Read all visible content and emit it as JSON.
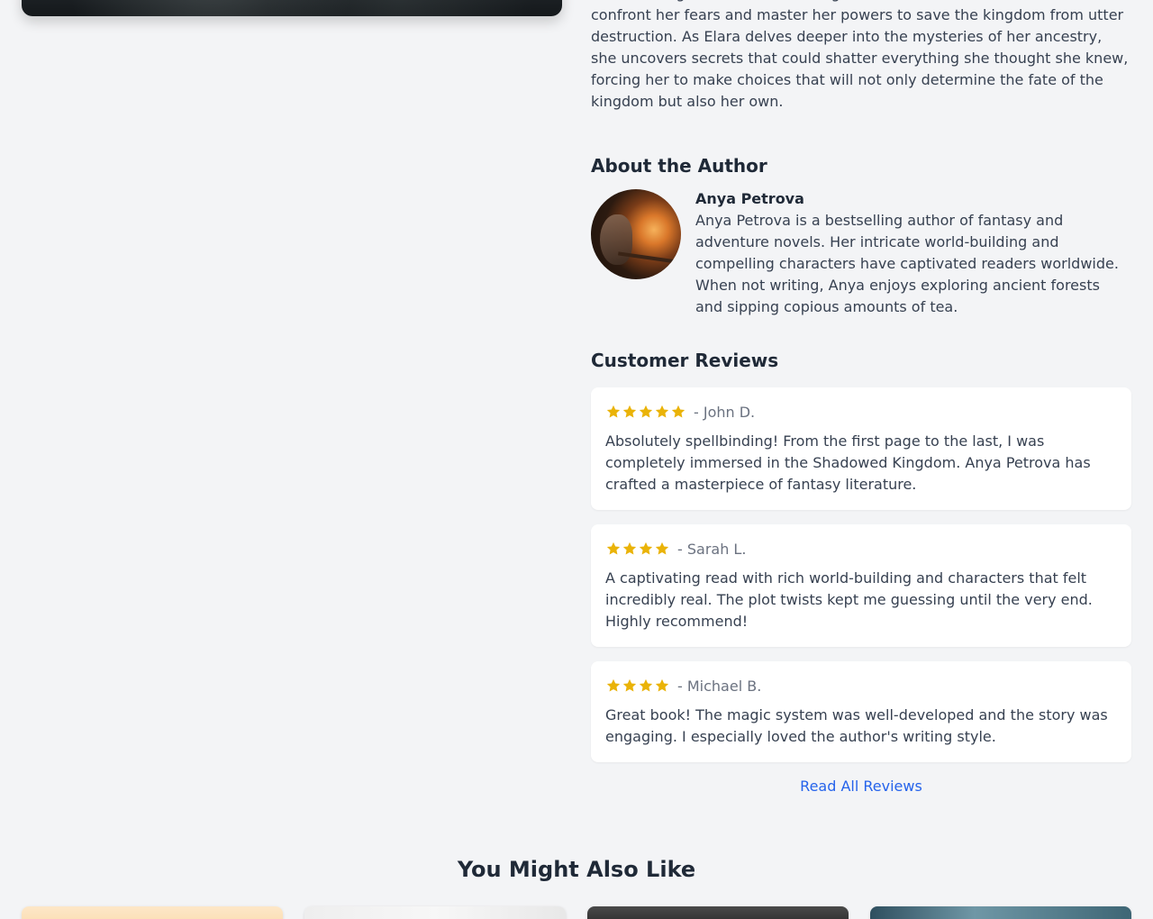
{
  "book": {
    "description": "– a stoic knight, a mischievous rogue, and a wise old scholar – she must confront her fears and master her powers to save the kingdom from utter destruction. As Elara delves deeper into the mysteries of her ancestry, she uncovers secrets that could shatter everything she thought she knew, forcing her to make choices that will not only determine the fate of the kingdom but also her own."
  },
  "author": {
    "heading": "About the Author",
    "name": "Anya Petrova",
    "bio": "Anya Petrova is a bestselling author of fantasy and adventure novels. Her intricate world-building and compelling characters have captivated readers worldwide. When not writing, Anya enjoys exploring ancient forests and sipping copious amounts of tea."
  },
  "reviews": {
    "heading": "Customer Reviews",
    "items": [
      {
        "rating": 5,
        "reviewer": "- John D.",
        "text": "Absolutely spellbinding! From the first page to the last, I was completely immersed in the Shadowed Kingdom. Anya Petrova has crafted a masterpiece of fantasy literature."
      },
      {
        "rating": 4,
        "reviewer": "- Sarah L.",
        "text": "A captivating read with rich world-building and characters that felt incredibly real. The plot twists kept me guessing until the very end. Highly recommend!"
      },
      {
        "rating": 4,
        "reviewer": "- Michael B.",
        "text": "Great book! The magic system was well-developed and the story was engaging. I especially loved the author's writing style."
      }
    ],
    "read_all_label": "Read All Reviews"
  },
  "also_like": {
    "heading": "You Might Also Like"
  },
  "colors": {
    "star": "#eab308",
    "link": "#2563eb",
    "background": "#f3f4f6"
  }
}
